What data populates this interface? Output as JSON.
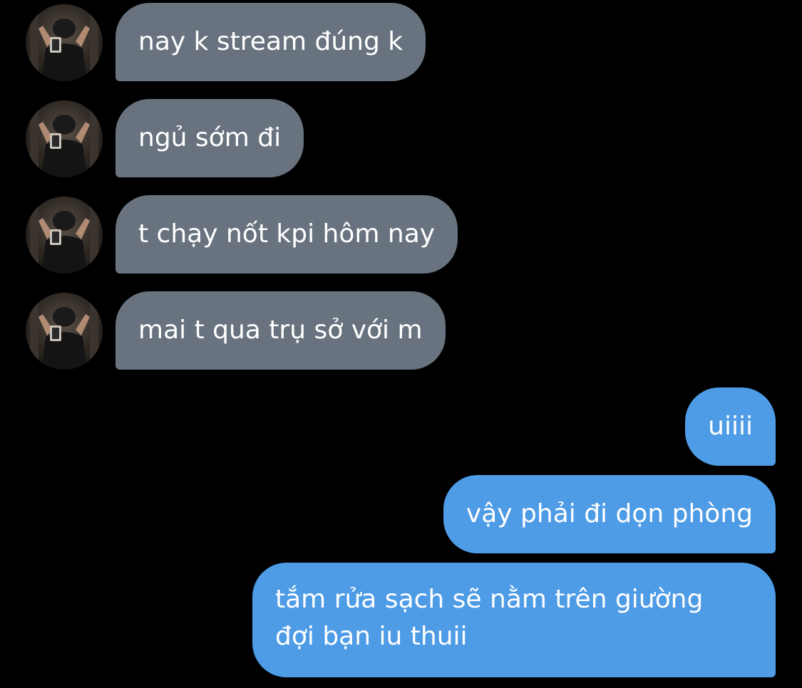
{
  "colors": {
    "background": "#000000",
    "incoming_bubble": "#68737f",
    "outgoing_bubble": "#4e9be6",
    "text": "#ffffff"
  },
  "messages": {
    "incoming": [
      {
        "text": "nay k stream đúng k"
      },
      {
        "text": "ngủ sớm đi"
      },
      {
        "text": "t chạy nốt kpi hôm nay"
      },
      {
        "text": "mai t qua trụ sở với m"
      }
    ],
    "outgoing": [
      {
        "text": "uiiii"
      },
      {
        "text": "vậy phải đi dọn phòng"
      },
      {
        "lines": [
          "tắm rửa sạch sẽ nằm trên giường",
          "đợi bạn iu thuii"
        ]
      }
    ]
  },
  "icons": {
    "avatar": "user-avatar-photo"
  }
}
